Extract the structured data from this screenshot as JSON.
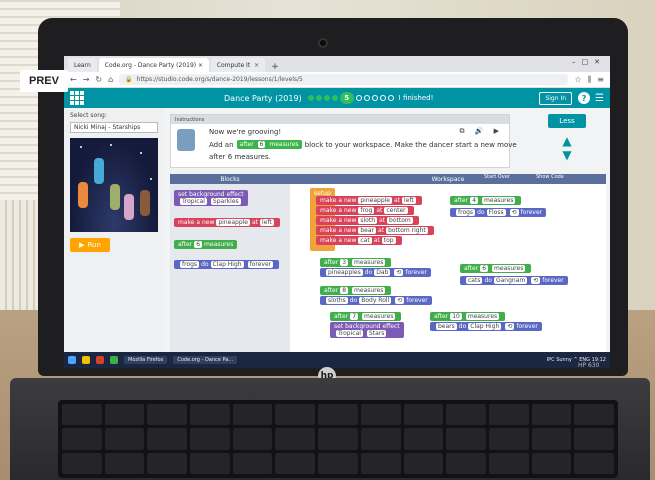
{
  "overlay": {
    "prev_label": "PREV"
  },
  "browser": {
    "tabs": [
      {
        "label": "Learn",
        "active": false
      },
      {
        "label": "Code.org - Dance Party (2019) ×",
        "active": true
      },
      {
        "label": "Compute It",
        "active": false
      }
    ],
    "new_tab": "+",
    "url": "https://studio.code.org/s/dance-2019/lessons/1/levels/5"
  },
  "app": {
    "title": "Dance Party (2019)",
    "current_level": "5",
    "finished_label": "I finished!",
    "sign_in_label": "Sign In"
  },
  "stage": {
    "select_song_label": "Select song:",
    "song_value": "Nicki Minaj - Starships",
    "run_label": "Run"
  },
  "instructions": {
    "header": "Instructions",
    "line1": "Now we're grooving!",
    "line2_prefix": "Add an",
    "line2_block_after": "after",
    "line2_block_num": "6",
    "line2_block_unit": "measures",
    "line2_suffix": "block to your workspace. Make the dancer start a new move",
    "line3": "after 6 measures.",
    "less_label": "Less"
  },
  "toolbox": {
    "header": "Blocks",
    "blocks": [
      {
        "text": "set background effect",
        "sub": "Tropical",
        "sub2": "Sparkles"
      },
      {
        "text": "make a new",
        "a": "pineapple",
        "b": "at",
        "c": "left"
      },
      {
        "text": "after",
        "a": "6",
        "b": "measures"
      },
      {
        "text": "frogs",
        "a": "do",
        "b": "Clap High",
        "c": "forever"
      }
    ]
  },
  "workspace": {
    "header": "Workspace",
    "start_over": "Start Over",
    "show_code": "Show Code",
    "setup_label": "setup",
    "setup_rows": [
      {
        "a": "pineapple",
        "c": "left"
      },
      {
        "a": "frog",
        "c": "center"
      },
      {
        "a": "sloth",
        "c": "bottom"
      },
      {
        "a": "bear",
        "c": "bottom right"
      },
      {
        "a": "cat",
        "c": "top"
      }
    ],
    "make_new": "make a new",
    "at": "at",
    "after_blocks": [
      {
        "num": "4",
        "target": "frogs",
        "move": "Floss",
        "loop": "forever"
      },
      {
        "num": "3",
        "target": "pineapples",
        "move": "Dab",
        "loop": "forever"
      },
      {
        "num": "6",
        "target": "cats",
        "move": "Gangnam",
        "loop": "forever"
      },
      {
        "num": "8",
        "target": "sloths",
        "move": "Body Roll",
        "loop": "forever"
      },
      {
        "num": "7",
        "bg": "set background effect",
        "bg_a": "Tropical",
        "bg_b": "Stars"
      },
      {
        "num": "10",
        "target": "bears",
        "move": "Clap High",
        "loop": "forever"
      }
    ],
    "after": "after",
    "measures": "measures",
    "do": "do"
  },
  "taskbar": {
    "items": [
      "Mozilla Firefox",
      "Code.org - Dance Pa..."
    ],
    "status": "IPC Sunny ^ ENG 19:12"
  },
  "device": {
    "model": "HP 630"
  },
  "colors": {
    "accent": "#0093a4",
    "run": "#ffa400",
    "green": "#3fae4b",
    "purple": "#7d5ab5",
    "red": "#d9435a"
  }
}
